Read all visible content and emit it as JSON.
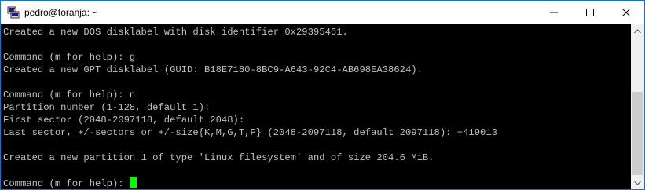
{
  "window": {
    "title": "pedro@toranja: ~"
  },
  "terminal": {
    "lines": [
      "Created a new DOS disklabel with disk identifier 0x29395461.",
      "",
      "Command (m for help): g",
      "Created a new GPT disklabel (GUID: B18E7180-8BC9-A643-92C4-AB698EA38624).",
      "",
      "Command (m for help): n",
      "Partition number (1-128, default 1):",
      "First sector (2048-2097118, default 2048):",
      "Last sector, +/-sectors or +/-size{K,M,G,T,P} (2048-2097118, default 2097118): +419013",
      "",
      "Created a new partition 1 of type 'Linux filesystem' and of size 204.6 MiB.",
      "",
      "Command (m for help): "
    ],
    "cursor_color": "#00ff00",
    "text_color": "#c0c0c0",
    "background": "#000000"
  },
  "icons": {
    "app": "putty-icon",
    "minimize": "minimize-icon",
    "maximize": "maximize-icon",
    "close": "close-icon",
    "scroll_up": "scroll-up-arrow-icon",
    "scroll_down": "scroll-down-arrow-icon"
  }
}
